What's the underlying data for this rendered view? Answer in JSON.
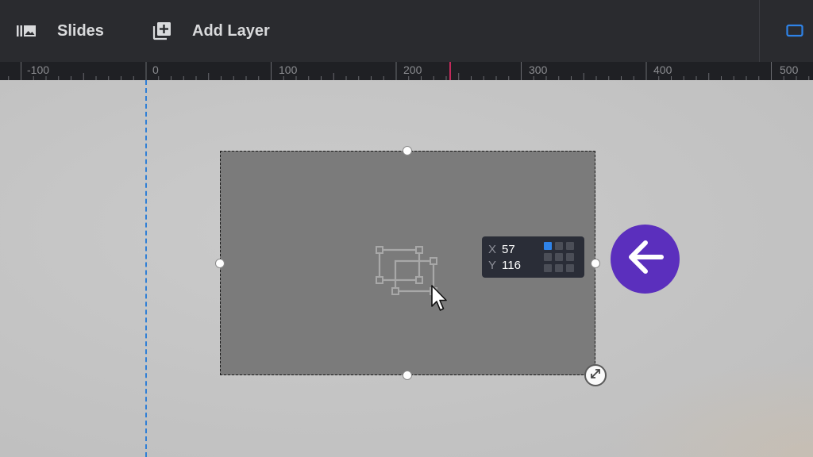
{
  "toolbar": {
    "slides_label": "Slides",
    "add_layer_label": "Add Layer",
    "slides_icon": "slides-library-icon",
    "add_layer_icon": "add-layer-icon",
    "right_icon": "screen-icon"
  },
  "ruler": {
    "labels": [
      "-100",
      "0",
      "100",
      "200",
      "300",
      "400",
      "500"
    ],
    "marker_color": "#c22a5b"
  },
  "coordinates": {
    "x_axis": "X",
    "x_value": "57",
    "y_axis": "Y",
    "y_value": "116",
    "active_anchor": "top-left"
  },
  "colors": {
    "toolbar_bg": "#2a2b2f",
    "accent": "#2f83e8",
    "back_button": "#5b2fbd",
    "layer_fill": "#7b7b7b"
  },
  "back_button": {
    "icon": "arrow-left-icon"
  }
}
